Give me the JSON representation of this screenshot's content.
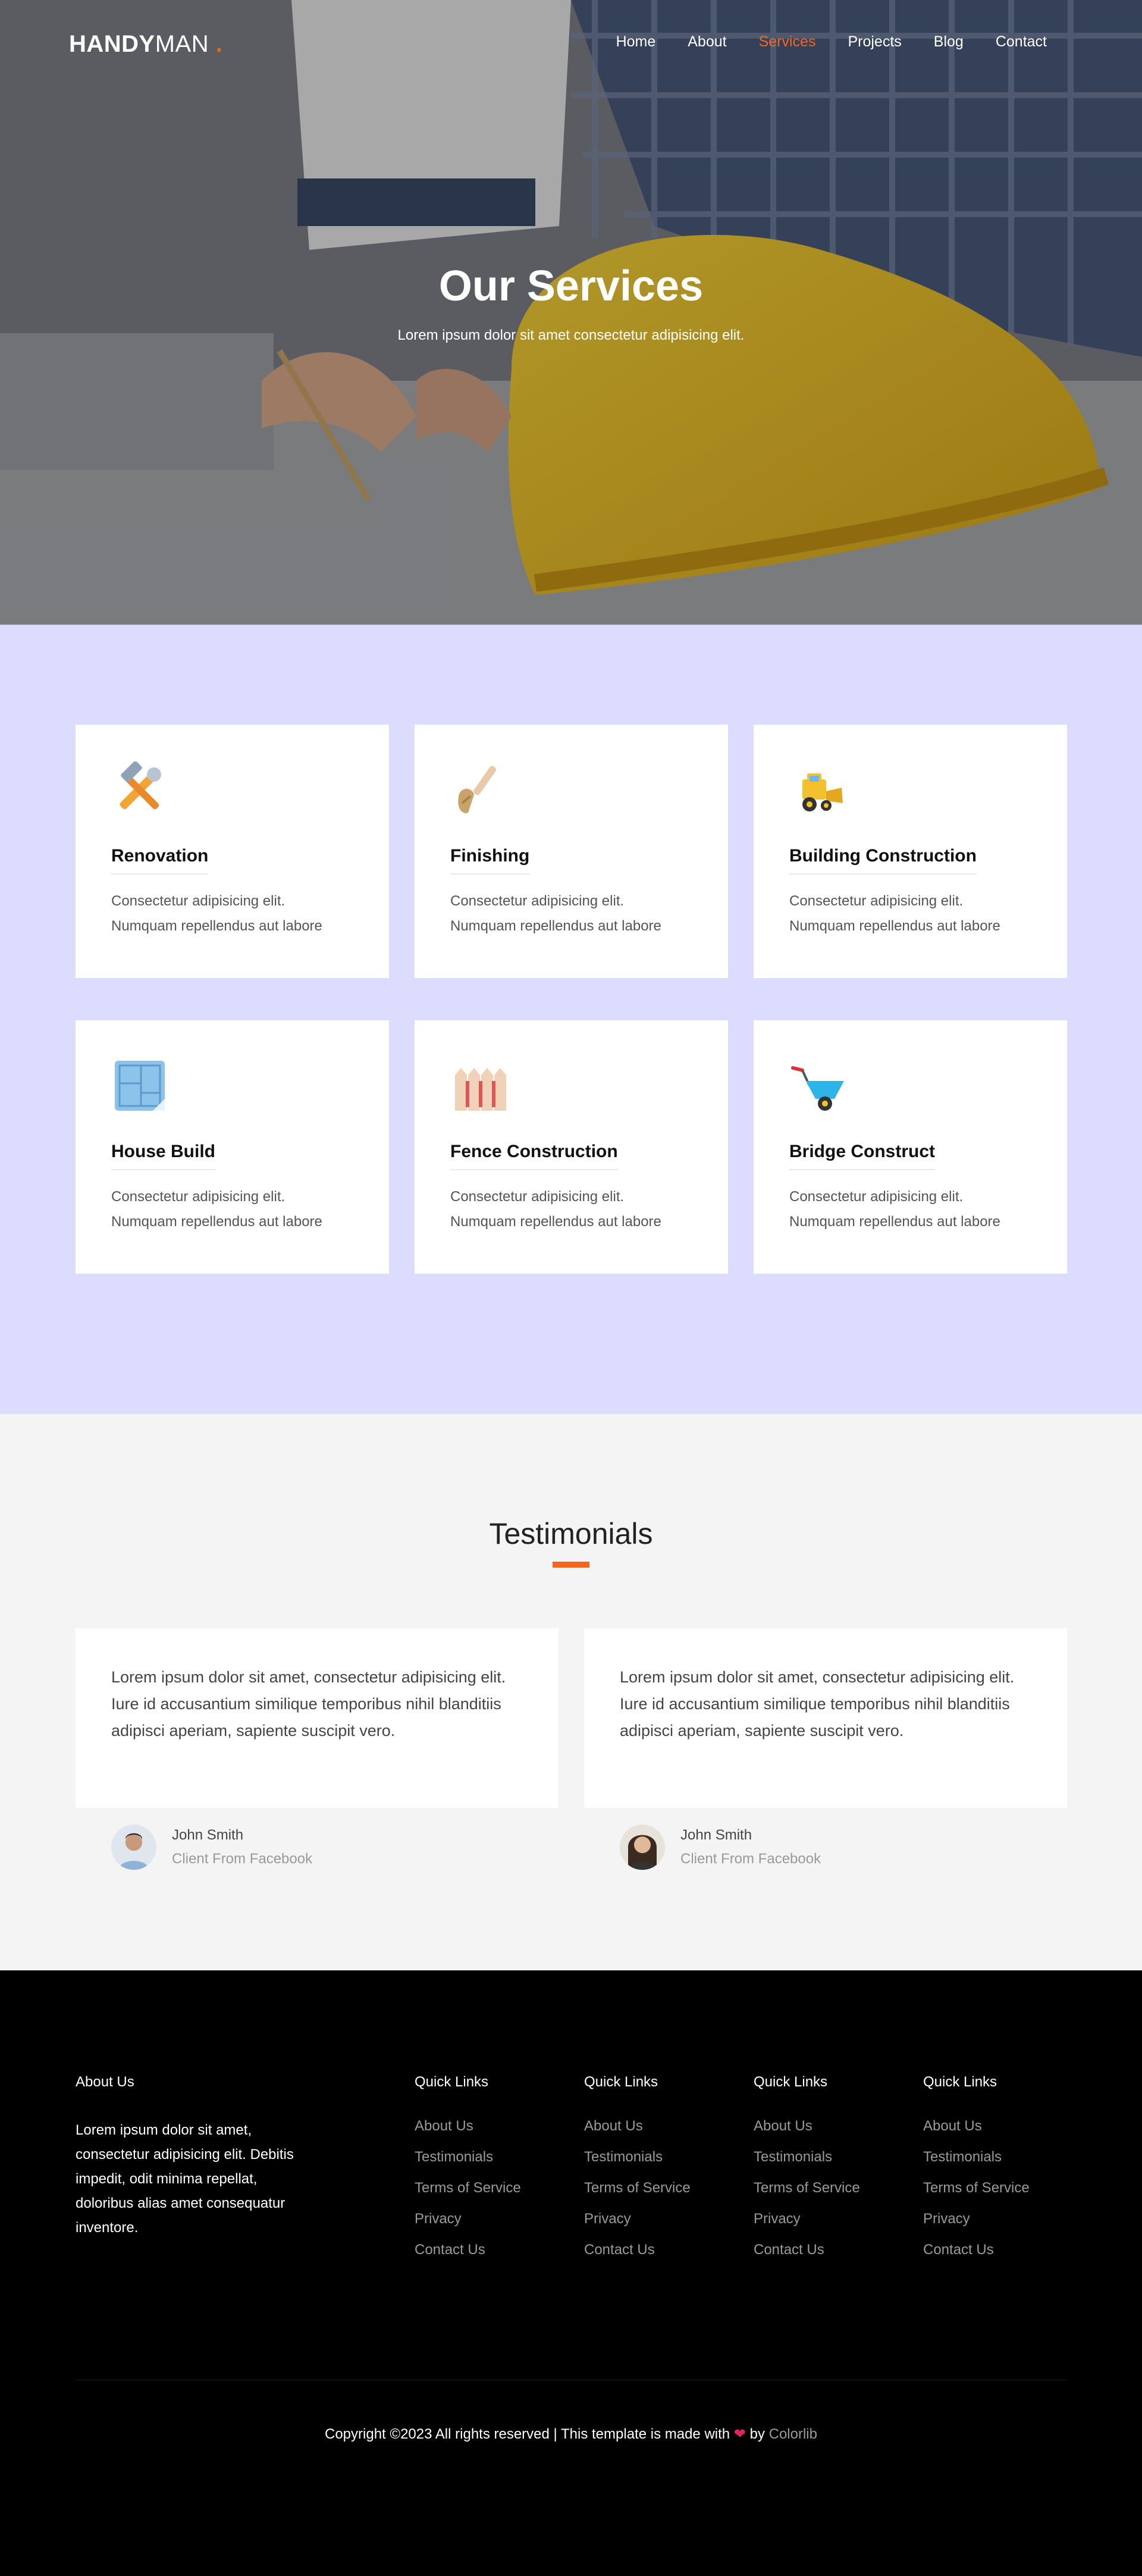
{
  "logo": {
    "bold": "HANDY",
    "light": "MAN",
    "dot": "."
  },
  "nav": [
    {
      "label": "Home",
      "active": false
    },
    {
      "label": "About",
      "active": false
    },
    {
      "label": "Services",
      "active": true
    },
    {
      "label": "Projects",
      "active": false
    },
    {
      "label": "Blog",
      "active": false
    },
    {
      "label": "Contact",
      "active": false
    }
  ],
  "hero": {
    "title": "Our Services",
    "subtitle": "Lorem ipsum dolor sit amet consectetur adipisicing elit."
  },
  "services": [
    {
      "title": "Renovation",
      "icon": "tools-icon",
      "text": "Consectetur adipisicing elit. Numquam repellendus aut labore"
    },
    {
      "title": "Finishing",
      "icon": "shovel-icon",
      "text": "Consectetur adipisicing elit. Numquam repellendus aut labore"
    },
    {
      "title": "Building Construction",
      "icon": "bulldozer-icon",
      "text": "Consectetur adipisicing elit. Numquam repellendus aut labore"
    },
    {
      "title": "House Build",
      "icon": "blueprint-icon",
      "text": "Consectetur adipisicing elit. Numquam repellendus aut labore"
    },
    {
      "title": "Fence Construction",
      "icon": "fence-icon",
      "text": "Consectetur adipisicing elit. Numquam repellendus aut labore"
    },
    {
      "title": "Bridge Construct",
      "icon": "wheelbarrow-icon",
      "text": "Consectetur adipisicing elit. Numquam repellendus aut labore"
    }
  ],
  "testimonials": {
    "title": "Testimonials",
    "items": [
      {
        "quote": "Lorem ipsum dolor sit amet, consectetur adipisicing elit. Iure id accusantium similique temporibus nihil blanditiis adipisci aperiam, sapiente suscipit vero.",
        "name": "John Smith",
        "source": "Client From Facebook"
      },
      {
        "quote": "Lorem ipsum dolor sit amet, consectetur adipisicing elit. Iure id accusantium similique temporibus nihil blanditiis adipisci aperiam, sapiente suscipit vero.",
        "name": "John Smith",
        "source": "Client From Facebook"
      }
    ]
  },
  "footer": {
    "about_title": "About Us",
    "about_text": "Lorem ipsum dolor sit amet, consectetur adipisicing elit. Debitis impedit, odit minima repellat, doloribus alias amet consequatur inventore.",
    "link_columns": [
      {
        "title": "Quick Links",
        "links": [
          "About Us",
          "Testimonials",
          "Terms of Service",
          "Privacy",
          "Contact Us"
        ]
      },
      {
        "title": "Quick Links",
        "links": [
          "About Us",
          "Testimonials",
          "Terms of Service",
          "Privacy",
          "Contact Us"
        ]
      },
      {
        "title": "Quick Links",
        "links": [
          "About Us",
          "Testimonials",
          "Terms of Service",
          "Privacy",
          "Contact Us"
        ]
      },
      {
        "title": "Quick Links",
        "links": [
          "About Us",
          "Testimonials",
          "Terms of Service",
          "Privacy",
          "Contact Us"
        ]
      }
    ],
    "copyright_prefix": "Copyright ©2023 All rights reserved | This template is made with",
    "copyright_by": "by",
    "copyright_link": "Colorlib"
  },
  "colors": {
    "accent": "#f26522",
    "services_bg": "#dcdcff",
    "testimonials_bg": "#f4f4f4",
    "footer_bg": "#000000"
  }
}
